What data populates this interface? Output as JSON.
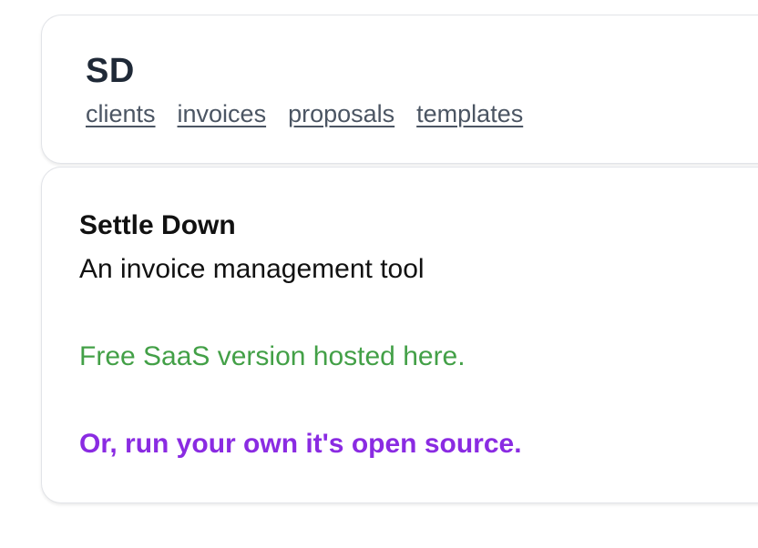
{
  "header": {
    "brand": "SD",
    "nav": [
      "clients",
      "invoices",
      "proposals",
      "templates"
    ]
  },
  "content": {
    "title": "Settle Down",
    "subtitle": "An invoice management tool",
    "saas_link": "Free SaaS version hosted here.",
    "oss_link": "Or, run your own it's open source."
  },
  "colors": {
    "saas_link": "#43a047",
    "oss_link": "#8a2be2",
    "nav_link": "#4b5563"
  }
}
